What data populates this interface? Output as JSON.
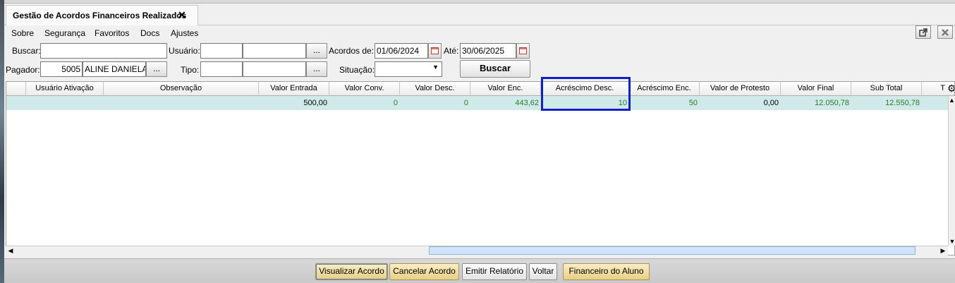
{
  "tab": {
    "title": "Gestão de Acordos Financeiros Realizados",
    "close": "✕"
  },
  "menu": [
    {
      "label": "Sobre"
    },
    {
      "label": "Segurança"
    },
    {
      "label": "Favoritos"
    },
    {
      "label": "Docs"
    },
    {
      "label": "Ajustes"
    }
  ],
  "filters": {
    "buscar_label": "Buscar:",
    "buscar_value": "",
    "usuario_label": "Usuário:",
    "usuario_code": "",
    "usuario_name": "",
    "acordos_de_label": "Acordos de:",
    "acordos_de_value": "01/06/2024",
    "ate_label": "Até:",
    "ate_value": "30/06/2025",
    "pagador_label": "Pagador:",
    "pagador_code": "5005",
    "pagador_name": "ALINE DANIELA",
    "tipo_label": "Tipo:",
    "tipo_code": "",
    "tipo_name": "",
    "situacao_label": "Situação:",
    "situacao_value": "",
    "lookup_button": "...",
    "buscar_button": "Buscar"
  },
  "grid": {
    "columns": [
      "",
      "Usuário Ativação",
      "Observação",
      "Valor Entrada",
      "Valor Conv.",
      "Valor Desc.",
      "Valor Enc.",
      "Acréscimo Desc.",
      "Acréscimo Enc.",
      "Valor de Protesto",
      "Valor Final",
      "Sub Total",
      "T"
    ],
    "rows": [
      [
        "",
        "",
        "",
        "500,00",
        "0",
        "0",
        "443,62",
        "10",
        "50",
        "0,00",
        "12.050,78",
        "12.550,78",
        ""
      ]
    ],
    "selected_column": "Acréscimo Desc."
  },
  "actions": {
    "visualizar": "Visualizar Acordo",
    "cancelar": "Cancelar Acordo",
    "emitir": "Emitir Relatório",
    "voltar": "Voltar",
    "financeiro": "Financeiro do Aluno"
  },
  "colors": {
    "row_bg": "#cfeae8",
    "selection": "#1020c8",
    "green_text": "#2d7a2d",
    "gold_button": "#e8cf86"
  }
}
